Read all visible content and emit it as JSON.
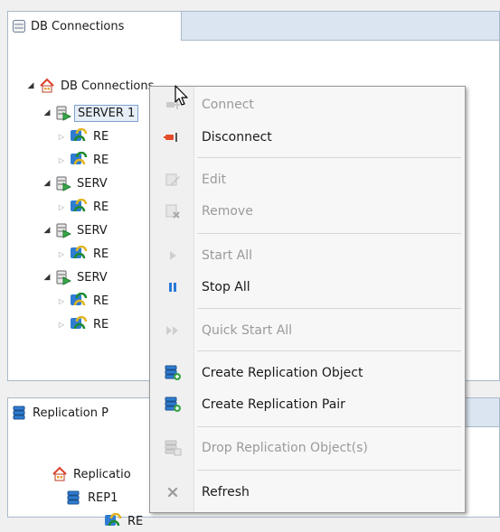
{
  "top_view": {
    "tab_label": "DB Connections",
    "tree": {
      "root_label": "DB Connections",
      "server1_label": "SERVER 1",
      "child_stub": "RE",
      "server_stub": "SERV"
    }
  },
  "bottom_view": {
    "tab_label": "Replication P",
    "tree": {
      "root_label": "Replicatio",
      "rep1_label": "REP1",
      "child_stub": "RE"
    }
  },
  "context_menu": {
    "items": [
      {
        "label": "Connect",
        "enabled": false,
        "icon": "connect-icon"
      },
      {
        "label": "Disconnect",
        "enabled": true,
        "icon": "disconnect-icon"
      },
      {
        "label": "Edit",
        "enabled": false,
        "icon": "edit-icon"
      },
      {
        "label": "Remove",
        "enabled": false,
        "icon": "remove-icon"
      },
      {
        "label": "Start All",
        "enabled": false,
        "icon": "start-all-icon"
      },
      {
        "label": "Stop All",
        "enabled": true,
        "icon": "stop-all-icon"
      },
      {
        "label": "Quick Start All",
        "enabled": false,
        "icon": "quick-start-icon"
      },
      {
        "label": "Create Replication Object",
        "enabled": true,
        "icon": "create-replication-object-icon"
      },
      {
        "label": "Create Replication Pair",
        "enabled": true,
        "icon": "create-replication-pair-icon"
      },
      {
        "label": "Drop Replication Object(s)",
        "enabled": false,
        "icon": "drop-replication-object-icon"
      },
      {
        "label": "Refresh",
        "enabled": true,
        "icon": "refresh-icon"
      }
    ]
  },
  "colors": {
    "accent": "#e34b2b",
    "stop_blue": "#2a7ad8",
    "disabled_text": "#9a9a9a"
  }
}
